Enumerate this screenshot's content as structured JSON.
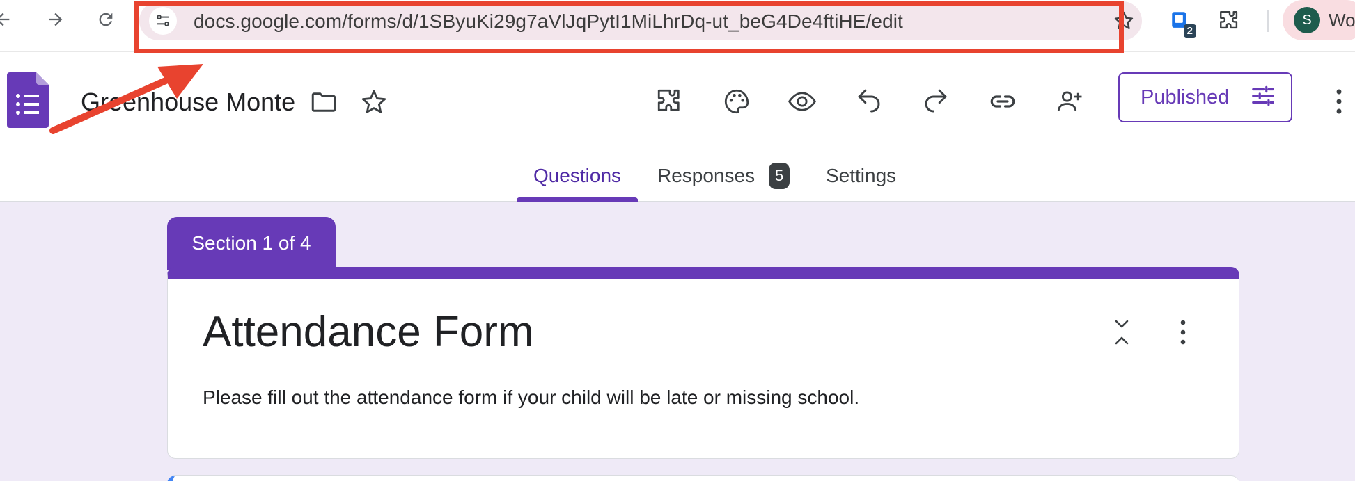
{
  "browser": {
    "url": "docs.google.com/forms/d/1SByuKi29g7aVlJqPytI1MiLhrDq-ut_beG4De4ftiHE/edit",
    "extension_badge": "2",
    "profile_initial": "S",
    "profile_name": "Wo",
    "icons": [
      "back-arrow-icon",
      "forward-arrow-icon",
      "reload-icon",
      "site-settings-icon",
      "bookmark-star-icon",
      "extension-icon",
      "puzzle-icon"
    ]
  },
  "header": {
    "doc_title": "Greenhouse Monte",
    "published_label": "Published",
    "icons": [
      "forms-logo-icon",
      "folder-icon",
      "star-icon",
      "addons-icon",
      "palette-icon",
      "preview-eye-icon",
      "undo-icon",
      "redo-icon",
      "link-icon",
      "add-collaborator-icon",
      "tune-icon",
      "more-vert-icon"
    ]
  },
  "tabs": [
    {
      "label": "Questions",
      "active": true
    },
    {
      "label": "Responses",
      "badge": "5"
    },
    {
      "label": "Settings"
    }
  ],
  "form": {
    "section_label": "Section 1 of 4",
    "title": "Attendance Form",
    "description": "Please fill out the attendance form if your child will be late or missing school."
  },
  "colors": {
    "accent": "#673ab7",
    "annotation": "#e8432f",
    "background": "#efeaf7"
  }
}
